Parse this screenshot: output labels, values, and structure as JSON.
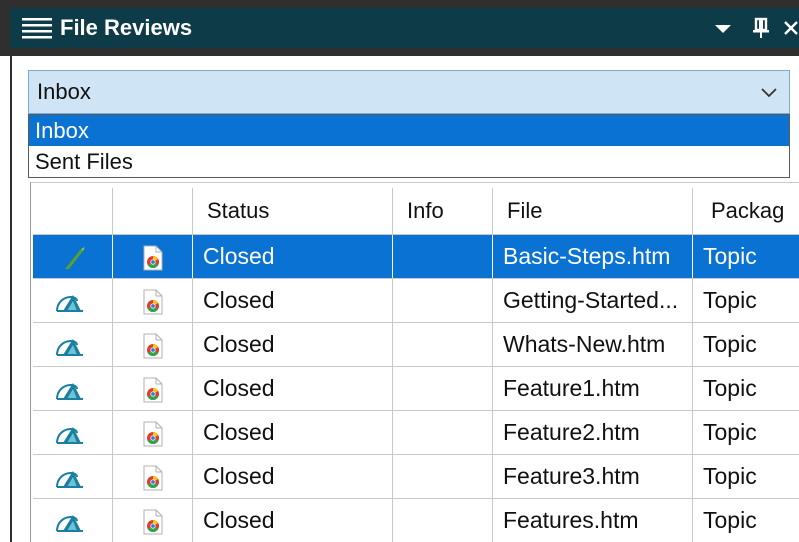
{
  "window": {
    "title": "File Reviews"
  },
  "combo": {
    "value": "Inbox"
  },
  "dropdown": {
    "options": [
      "Inbox",
      "Sent Files"
    ]
  },
  "table": {
    "headers": [
      "",
      "",
      "Status",
      "Info",
      "File",
      "Packag"
    ],
    "rows": [
      {
        "status": "Closed",
        "info": "",
        "file": "Basic-Steps.htm",
        "package": "Topic"
      },
      {
        "status": "Closed",
        "info": "",
        "file": "Getting-Started...",
        "package": "Topic"
      },
      {
        "status": "Closed",
        "info": "",
        "file": "Whats-New.htm",
        "package": "Topic"
      },
      {
        "status": "Closed",
        "info": "",
        "file": "Feature1.htm",
        "package": "Topic"
      },
      {
        "status": "Closed",
        "info": "",
        "file": "Feature2.htm",
        "package": "Topic"
      },
      {
        "status": "Closed",
        "info": "",
        "file": "Feature3.htm",
        "package": "Topic"
      },
      {
        "status": "Closed",
        "info": "",
        "file": "Features.htm",
        "package": "Topic"
      }
    ]
  },
  "icons": {
    "menu": "hamburger-icon",
    "dropdown": "dropdown-arrow-icon",
    "pin": "pin-icon",
    "close": "close-icon",
    "review": "review-status-icon",
    "file": "html-file-icon",
    "combo_arrow": "chevron-down-icon"
  },
  "colors": {
    "titlebar": "#0d3b48",
    "selection": "#0a72d3",
    "combo_background": "#cfe4f5"
  }
}
